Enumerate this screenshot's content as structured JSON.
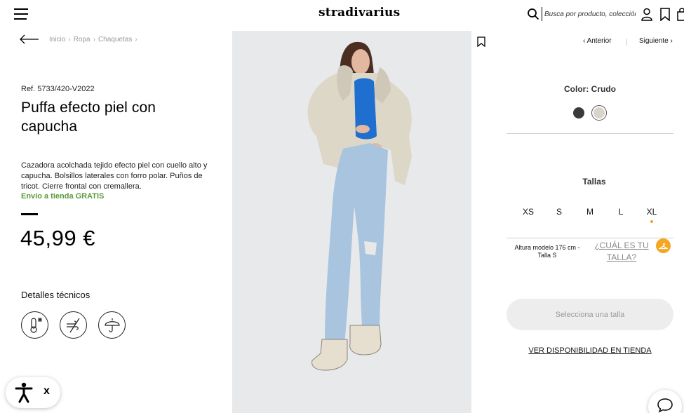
{
  "header": {
    "logo": "stradivarius",
    "search_placeholder": "Busca por producto, colección..."
  },
  "breadcrumb": [
    "Inicio",
    "Ropa",
    "Chaquetas"
  ],
  "product": {
    "ref": "Ref. 5733/420-V2022",
    "title": "Puffa efecto piel con capucha",
    "description": "Cazadora acolchada tejido efecto piel con cuello alto y capucha. Bolsillos laterales con forro polar. Puños de tricot. Cierre frontal con cremallera.",
    "shipping": "Envío a tienda GRATIS",
    "price": "45,99 €",
    "tech_details_label": "Detalles técnicos"
  },
  "navigation": {
    "prev": "Anterior",
    "next": "Siguiente"
  },
  "color": {
    "label": "Color: Crudo",
    "swatches": [
      "#3a3a3c",
      "#d9d4cb"
    ]
  },
  "sizes": {
    "label": "Tallas",
    "options": [
      "XS",
      "S",
      "M",
      "L",
      "XL"
    ],
    "model_info": "Altura modelo 176 cm - Talla S",
    "guide_link": "¿CUÁL ES TU TALLA?"
  },
  "actions": {
    "select_size": "Selecciona una talla",
    "store_availability": "VER DISPONIBILIDAD EN TIENDA"
  },
  "accessibility": {
    "close": "x"
  },
  "colors": {
    "shipping_green": "#5a9a3a",
    "accent_orange": "#f5a623"
  }
}
